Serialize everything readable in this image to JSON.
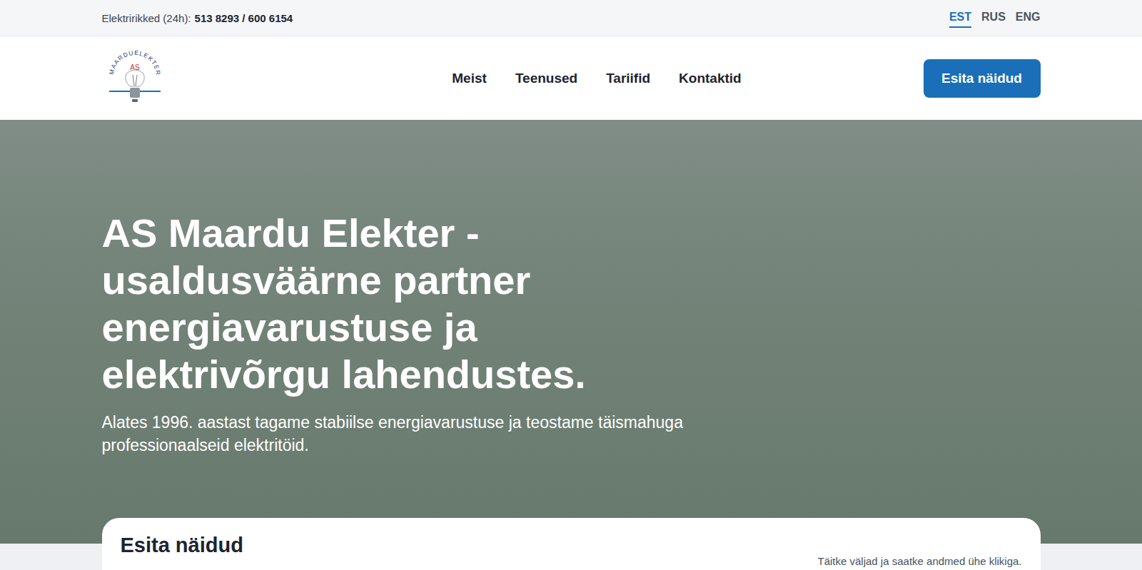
{
  "topbar": {
    "label": "Elektririkked (24h):",
    "phones": "513 8293 / 600 6154",
    "languages": [
      {
        "label": "EST",
        "selected": true
      },
      {
        "label": "RUS",
        "selected": false
      },
      {
        "label": "ENG",
        "selected": false
      }
    ]
  },
  "logo": {
    "arc": "MAARDUELEKTER",
    "center": "AS"
  },
  "nav": {
    "items": [
      "Meist",
      "Teenused",
      "Tariifid",
      "Kontaktid"
    ],
    "button": "Esita näidud"
  },
  "hero": {
    "heading_lines": [
      "AS Maardu Elekter -",
      "usaldusväärne partner",
      "energiavarustuse ja",
      "elektrivõrgu lahendustes."
    ],
    "subtitle_lines": [
      "Alates 1996. aastast tagame stabiilse energiavarustuse ja teostame täismahuga",
      "professionaalseid elektritöid."
    ]
  },
  "card": {
    "title": "Esita näidud",
    "hint": "Täitke väljad ja saatke andmed ühe klikiga."
  }
}
